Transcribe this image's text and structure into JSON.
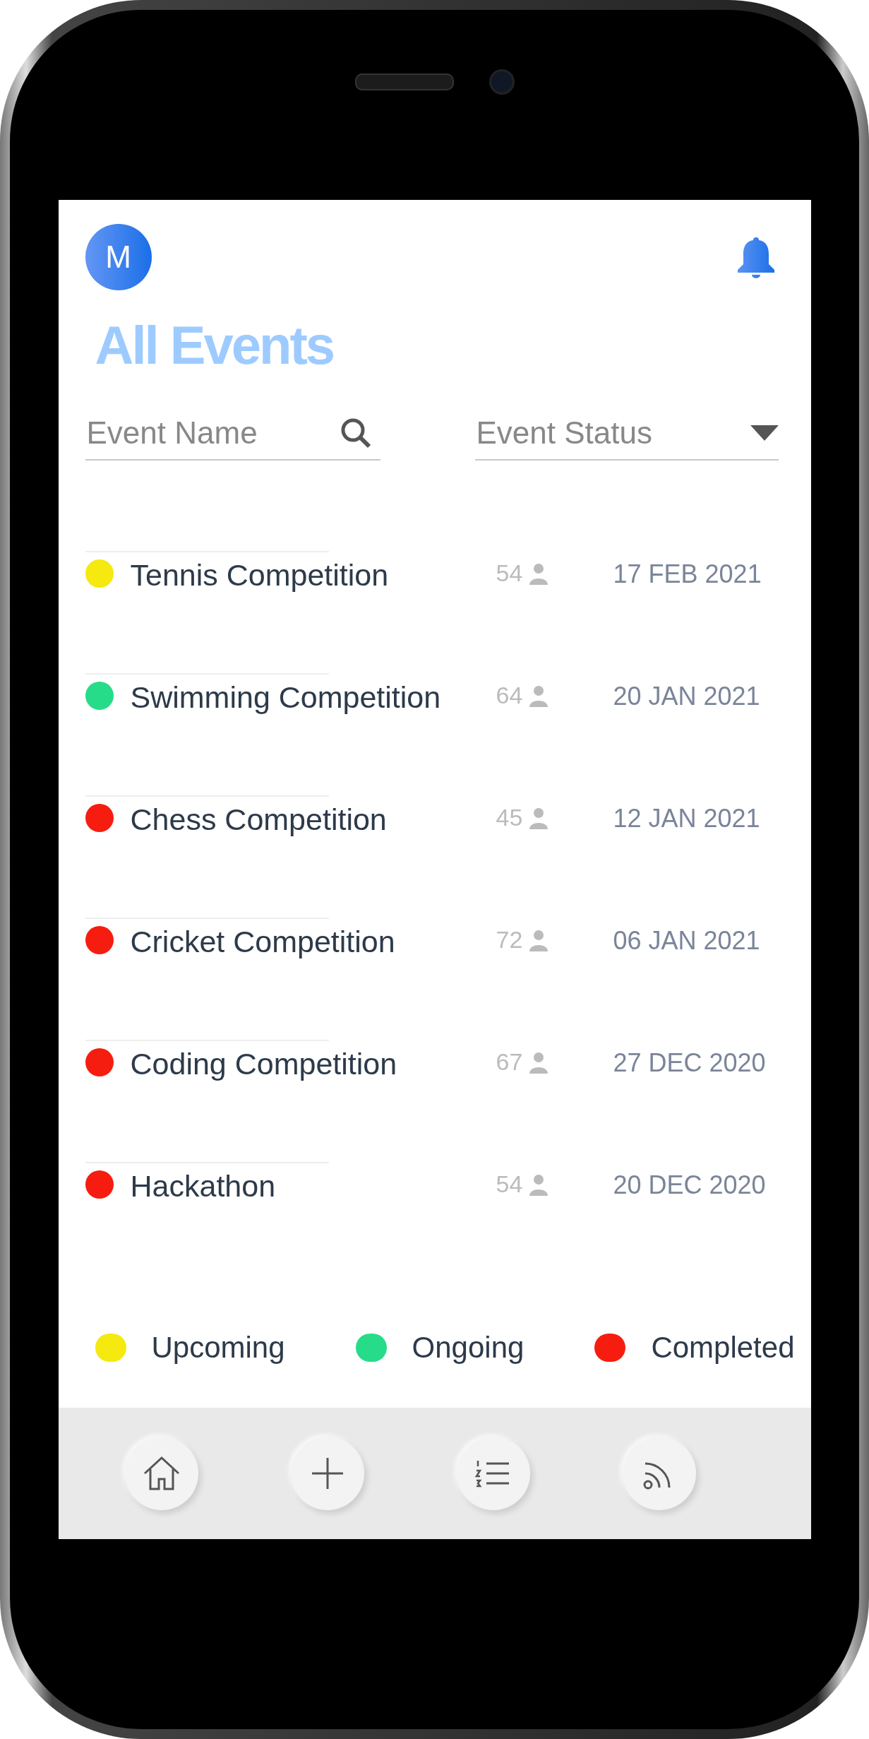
{
  "header": {
    "avatar_initial": "M",
    "title": "All Events"
  },
  "filters": {
    "name_field": {
      "placeholder": "Event Name"
    },
    "status_field": {
      "placeholder": "Event Status"
    }
  },
  "events": [
    {
      "name": "Tennis Competition",
      "count": "54",
      "date": "17 FEB 2021",
      "color": "#f5e90f"
    },
    {
      "name": "Swimming Competition",
      "count": "64",
      "date": "20 JAN 2021",
      "color": "#27dc88"
    },
    {
      "name": "Chess Competition",
      "count": "45",
      "date": "12 JAN 2021",
      "color": "#f61d10"
    },
    {
      "name": "Cricket Competition",
      "count": "72",
      "date": "06 JAN 2021",
      "color": "#f61d10"
    },
    {
      "name": "Coding Competition",
      "count": "67",
      "date": "27 DEC 2020",
      "color": "#f61d10"
    },
    {
      "name": "Hackathon",
      "count": "54",
      "date": "20 DEC 2020",
      "color": "#f61d10"
    }
  ],
  "legend": [
    {
      "label": "Upcoming",
      "color": "#f5e90f"
    },
    {
      "label": "Ongoing",
      "color": "#27dc88"
    },
    {
      "label": "Completed",
      "color": "#f61d10"
    }
  ],
  "bottom_nav": [
    {
      "kind": "home"
    },
    {
      "kind": "add"
    },
    {
      "kind": "list"
    },
    {
      "kind": "feed"
    }
  ]
}
